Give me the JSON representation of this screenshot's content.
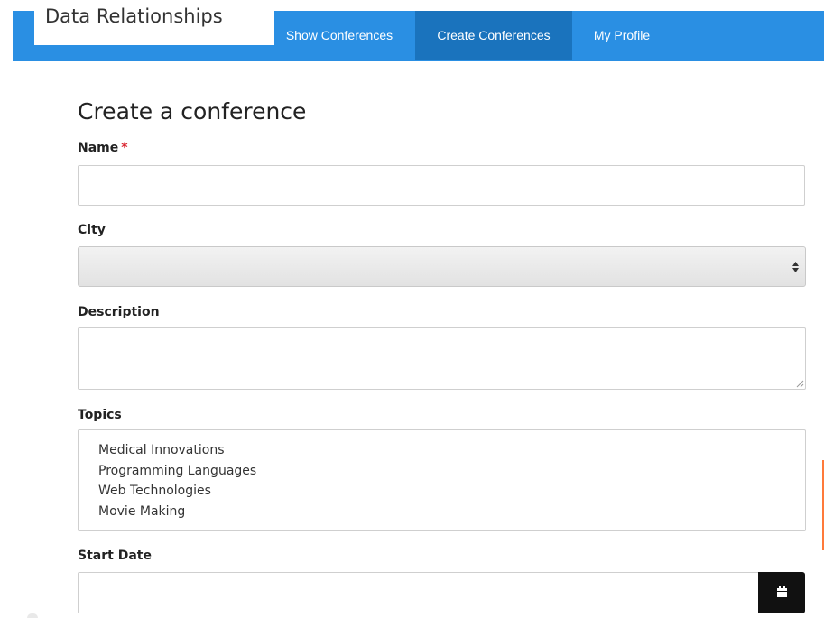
{
  "app": {
    "brand": "Data Relationships"
  },
  "nav": {
    "items": [
      {
        "label": "Show Conferences",
        "active": false
      },
      {
        "label": "Create Conferences",
        "active": true
      },
      {
        "label": "My Profile",
        "active": false
      }
    ],
    "color": "#2a8fe3",
    "active_color": "#1a73bd"
  },
  "form": {
    "title": "Create a conference",
    "name": {
      "label": "Name",
      "required_marker": "*",
      "value": ""
    },
    "city": {
      "label": "City",
      "selected": ""
    },
    "description": {
      "label": "Description",
      "value": ""
    },
    "topics": {
      "label": "Topics",
      "options": [
        "Medical Innovations",
        "Programming Languages",
        "Web Technologies",
        "Movie Making"
      ]
    },
    "start_date": {
      "label": "Start Date",
      "value": "",
      "button_icon": "calendar-icon"
    }
  },
  "icons": {
    "select_arrows": "sort-arrows-icon",
    "resize": "resize-grip-icon"
  }
}
